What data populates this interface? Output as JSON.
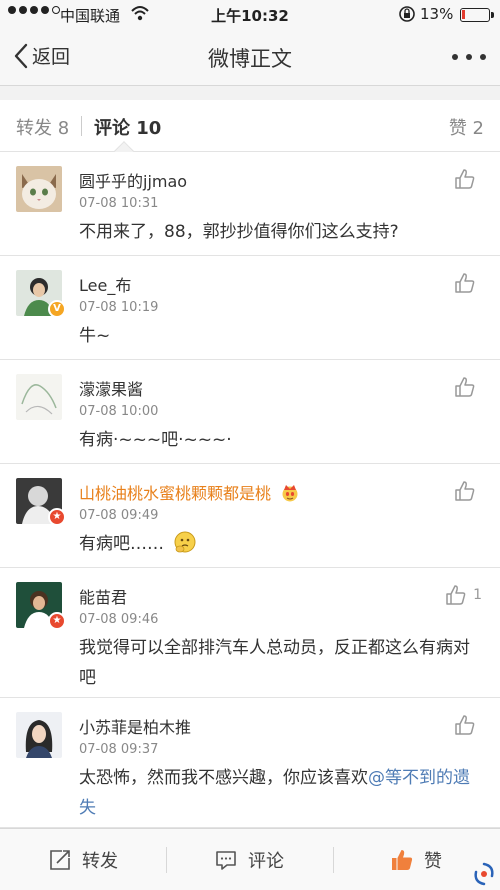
{
  "status_bar": {
    "carrier": "中国联通",
    "time": "上午10:32",
    "battery": "13%",
    "battery_level": 0.13,
    "signal_bars_filled": 4,
    "signal_bars_total": 5
  },
  "nav": {
    "back_label": "返回",
    "title": "微博正文"
  },
  "tabs": {
    "repost": "转发 8",
    "comments": "评论 10",
    "likes": "赞 2"
  },
  "comments": [
    {
      "user": "圆乎乎的jjmao",
      "time": "07-08 10:31",
      "text": "不用来了，88，郭抄抄值得你们这么支持?",
      "likes": "",
      "badge": ""
    },
    {
      "user": "Lee_布",
      "time": "07-08 10:19",
      "text": "牛~",
      "likes": "",
      "badge": "V"
    },
    {
      "user": "濛濛果酱",
      "time": "07-08 10:00",
      "text": "有病·~~~吧·~~~·",
      "likes": "",
      "badge": ""
    },
    {
      "user": "山桃油桃水蜜桃颗颗都是桃",
      "time": "07-08 09:49",
      "text": "有病吧……",
      "likes": "",
      "badge": "star"
    },
    {
      "user": "能苗君",
      "time": "07-08 09:46",
      "text": "我觉得可以全部排汽车人总动员，反正都这么有病对吧",
      "likes": "1",
      "badge": "star"
    },
    {
      "user": "小苏菲是柏木推",
      "time": "07-08 09:37",
      "text_plain": "太恐怖，然而我不感兴趣，你应该喜欢",
      "mention": "@等不到的遗失",
      "likes": "",
      "badge": ""
    }
  ],
  "bottom_bar": {
    "repost": "转发",
    "comment": "评论",
    "like": "赞"
  },
  "colors": {
    "accent_orange": "#e8811c",
    "mention_blue": "#4f7cb5",
    "like_orange": "#f0803c"
  }
}
